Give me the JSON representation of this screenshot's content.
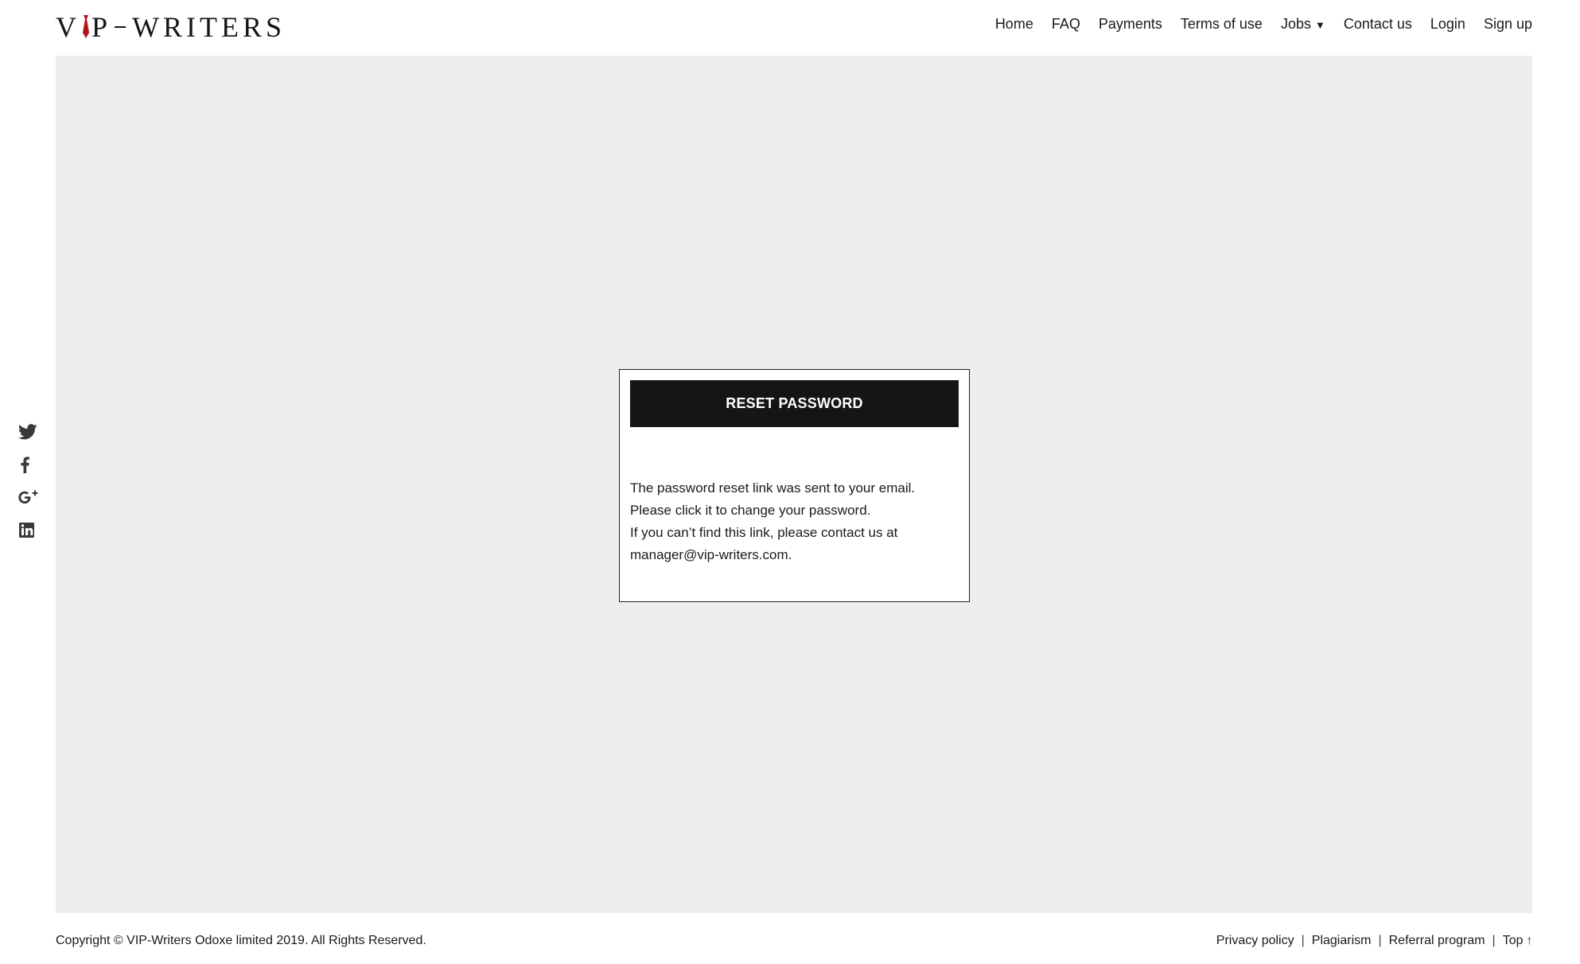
{
  "logo": {
    "text_left": "V",
    "text_mid": "P",
    "text_right": "WRITERS",
    "accent_color": "#b0141b"
  },
  "nav": {
    "items": [
      {
        "label": "Home"
      },
      {
        "label": "FAQ"
      },
      {
        "label": "Payments"
      },
      {
        "label": "Terms of use"
      },
      {
        "label": "Jobs",
        "dropdown": true,
        "caret": "▼"
      },
      {
        "label": "Contact us"
      },
      {
        "label": "Login"
      },
      {
        "label": "Sign up"
      }
    ]
  },
  "card": {
    "title": "RESET PASSWORD",
    "lines": [
      "The password reset link was sent to your email.",
      "Please click it to change your password.",
      "If you can’t find this link, please contact us at",
      "manager@vip-writers.com."
    ]
  },
  "social": {
    "icons": [
      "twitter-icon",
      "facebook-icon",
      "google-plus-icon",
      "linkedin-icon"
    ],
    "color": "#3a3a3a"
  },
  "footer": {
    "copyright": "Copyright © VIP-Writers Odoxe limited 2019. All Rights Reserved.",
    "links": [
      {
        "label": "Privacy policy"
      },
      {
        "label": "Plagiarism"
      },
      {
        "label": "Referral program"
      },
      {
        "label": "Top",
        "arrow": "↑"
      }
    ],
    "separator": "|"
  },
  "colors": {
    "background_main": "#eeeeee",
    "title_bar": "#151515",
    "text": "#1a1a1a"
  }
}
